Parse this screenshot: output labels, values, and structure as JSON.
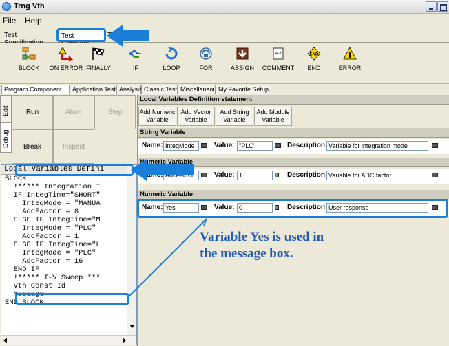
{
  "window": {
    "title": "Trng Vth"
  },
  "menu": [
    "File",
    "Help"
  ],
  "top_tabs": [
    "Test Specification",
    "Test Contents",
    "T"
  ],
  "toolbar": [
    {
      "label": "BLOCK",
      "icon": "block-icon"
    },
    {
      "label": "ON ERROR",
      "icon": "on-error-icon"
    },
    {
      "label": "FINALLY",
      "icon": "checkered-flag-icon"
    },
    {
      "label": "IF",
      "icon": "if-branch-icon"
    },
    {
      "label": "LOOP",
      "icon": "loop-icon"
    },
    {
      "label": "FOR",
      "icon": "for-icon"
    },
    {
      "label": "ASSIGN",
      "icon": "assign-icon"
    },
    {
      "label": "COMMENT",
      "icon": "comment-icon"
    },
    {
      "label": "END",
      "icon": "end-icon"
    },
    {
      "label": "ERROR",
      "icon": "warning-icon"
    }
  ],
  "component_tabs": [
    "Program Component",
    "Application Test",
    "Analysis",
    "Classic Test",
    "Miscellaneous",
    "My Favorite Setup"
  ],
  "side_tabs": [
    "Edit",
    "Debug"
  ],
  "controls": {
    "run": "Run",
    "abort": "Abort",
    "step": "Step",
    "break": "Break",
    "inspect": "Inspect"
  },
  "code": {
    "header": "Local Variables Defini",
    "lines": [
      "BLOCK",
      "  !***** Integration T",
      "  IF IntegTime=\"SHORT\"",
      "    IntegMode = \"MANUA",
      "    AdcFactor = 8",
      "  ELSE IF IntegTime=\"M",
      "    IntegMode = \"PLC\"",
      "    AdcFactor = 1",
      "  ELSE IF IntegTime=\"L",
      "    IntegMode = \"PLC\"",
      "    AdcFactor = 16",
      "  END IF",
      "  !***** I-V Sweep ***",
      "  Vth Const Id",
      "  Message",
      "END BLOCK"
    ]
  },
  "local_vars": {
    "title": "Local Variables Definition statement",
    "add_buttons": [
      "Add Numeric Variable",
      "Add Vector Variable",
      "Add String Variable",
      "Add Module Variable"
    ],
    "sections": [
      {
        "header": "String Variable",
        "name": "IntegMode",
        "value": "\"PLC\"",
        "description": "Variable for integration mode"
      },
      {
        "header": "Numeric Variable",
        "name": "AdcFactor",
        "value": "1",
        "description": "Variable for ADC factor"
      },
      {
        "header": "Numeric Variable",
        "name": "Yes",
        "value": "0",
        "description": "User response"
      }
    ],
    "labels": {
      "name": "Name:",
      "value": "Value:",
      "description": "Description:"
    }
  },
  "annotation": {
    "line1": "Variable Yes is used in",
    "line2": "the message box."
  },
  "colors": {
    "highlight": "#1a7fd8",
    "annotation_text": "#1f5bb5",
    "panel_bg": "#ece9d8"
  }
}
